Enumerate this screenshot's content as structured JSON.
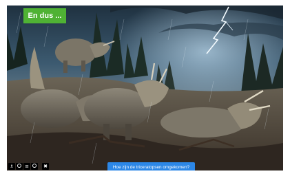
{
  "badge": {
    "title": "En dus ..."
  },
  "question": {
    "label": "Hoe zijn de triceratopsen omgekomen?"
  },
  "license": {
    "icons": [
      "creative-commons-icon",
      "attribution-icon",
      "share-alike-icon",
      "noncommercial-icon",
      "public-domain-icon"
    ]
  },
  "colors": {
    "badge_bg": "#4fb234",
    "button_bg": "#2c87e7",
    "text": "#ffffff"
  }
}
